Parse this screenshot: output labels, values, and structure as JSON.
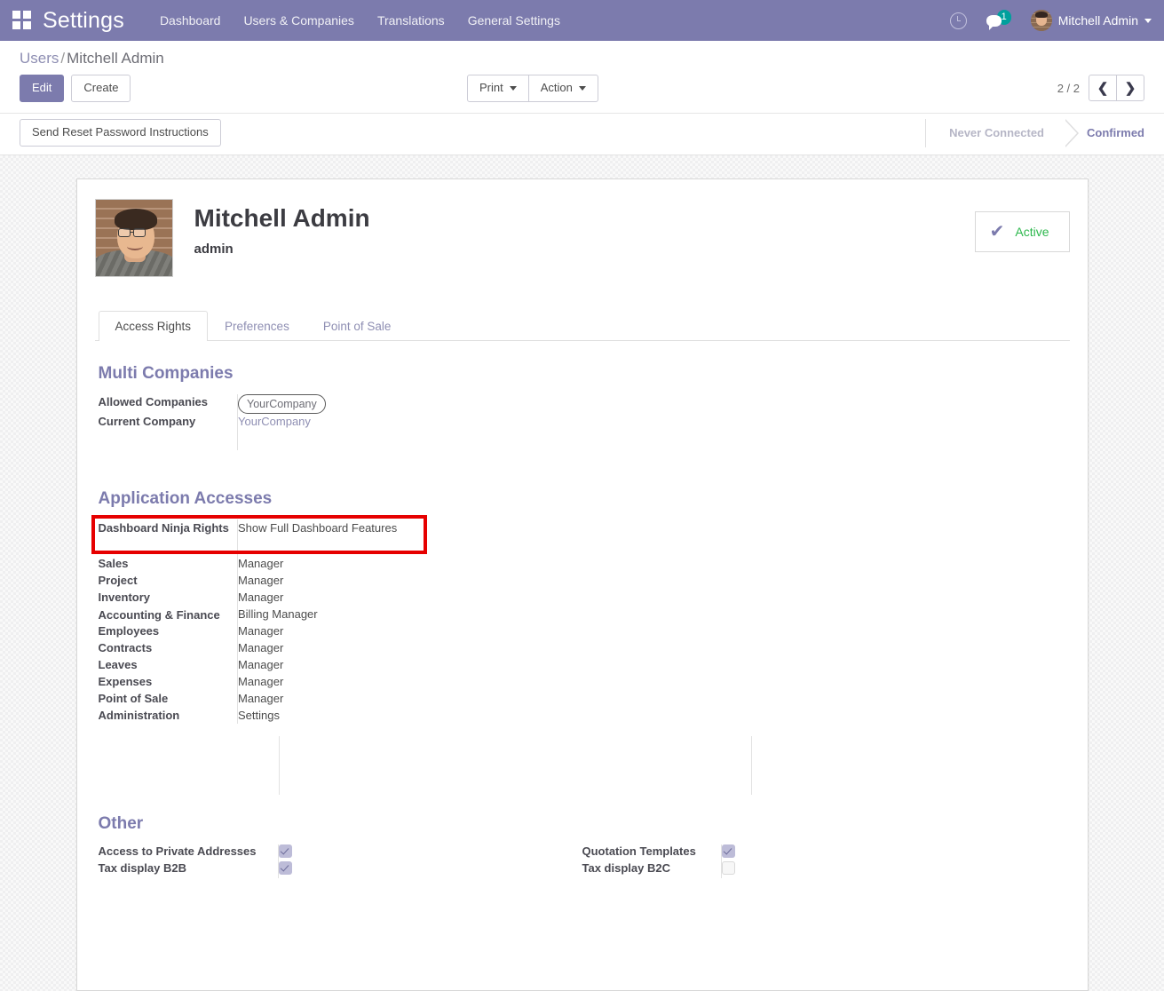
{
  "navbar": {
    "apps_icon": "apps-grid-icon",
    "brand": "Settings",
    "menu": [
      {
        "label": "Dashboard"
      },
      {
        "label": "Users & Companies"
      },
      {
        "label": "Translations"
      },
      {
        "label": "General Settings"
      }
    ],
    "activity_icon": "clock-icon",
    "messaging_icon": "chat-bubble-icon",
    "messaging_count": "1",
    "user_name": "Mitchell Admin",
    "user_caret": "chevron-down-icon",
    "accent_color": "#7c7bad",
    "badge_color": "#00a09d"
  },
  "control_panel": {
    "breadcrumb_root": "Users",
    "breadcrumb_sep": "/",
    "breadcrumb_current": "Mitchell Admin",
    "edit_label": "Edit",
    "create_label": "Create",
    "print_label": "Print",
    "action_label": "Action",
    "pager_value": "2 / 2",
    "pager_prev_icon": "chevron-left-icon",
    "pager_next_icon": "chevron-right-icon",
    "pager_prev_glyph": "❮",
    "pager_next_glyph": "❯"
  },
  "status_row": {
    "reset_password_button": "Send Reset Password Instructions",
    "statusbar": [
      {
        "label": "Never Connected",
        "active": false
      },
      {
        "label": "Confirmed",
        "active": true
      }
    ]
  },
  "record": {
    "avatar": "user-photo",
    "title": "Mitchell Admin",
    "subtitle": "admin",
    "active_check_icon": "check-icon",
    "active_check_glyph": "✔",
    "active_label": "Active",
    "active_color": "#2db84d"
  },
  "tabs": [
    {
      "label": "Access Rights",
      "active": true
    },
    {
      "label": "Preferences",
      "active": false
    },
    {
      "label": "Point of Sale",
      "active": false
    }
  ],
  "multi_companies": {
    "section_title": "Multi Companies",
    "allowed_companies_label": "Allowed Companies",
    "allowed_companies_tag": "YourCompany",
    "current_company_label": "Current Company",
    "current_company_value": "YourCompany"
  },
  "application_accesses": {
    "section_title": "Application Accesses",
    "rows": [
      {
        "label": "Dashboard Ninja Rights",
        "value": "Show Full Dashboard Features",
        "highlighted": true
      },
      {
        "label": "Sales",
        "value": "Manager",
        "highlighted": false
      },
      {
        "label": "Project",
        "value": "Manager",
        "highlighted": false
      },
      {
        "label": "Inventory",
        "value": "Manager",
        "highlighted": false
      },
      {
        "label": "Accounting & Finance",
        "value": "Billing Manager",
        "highlighted": false
      },
      {
        "label": "Employees",
        "value": "Manager",
        "highlighted": false
      },
      {
        "label": "Contracts",
        "value": "Manager",
        "highlighted": false
      },
      {
        "label": "Leaves",
        "value": "Manager",
        "highlighted": false
      },
      {
        "label": "Expenses",
        "value": "Manager",
        "highlighted": false
      },
      {
        "label": "Point of Sale",
        "value": "Manager",
        "highlighted": false
      },
      {
        "label": "Administration",
        "value": "Settings",
        "highlighted": false
      }
    ],
    "highlight_color": "#e60000"
  },
  "other": {
    "section_title": "Other",
    "left": [
      {
        "label": "Access to Private Addresses",
        "checked": true
      },
      {
        "label": "Tax display B2B",
        "checked": true
      }
    ],
    "right": [
      {
        "label": "Quotation Templates",
        "checked": true
      },
      {
        "label": "Tax display B2C",
        "checked": false
      }
    ]
  }
}
